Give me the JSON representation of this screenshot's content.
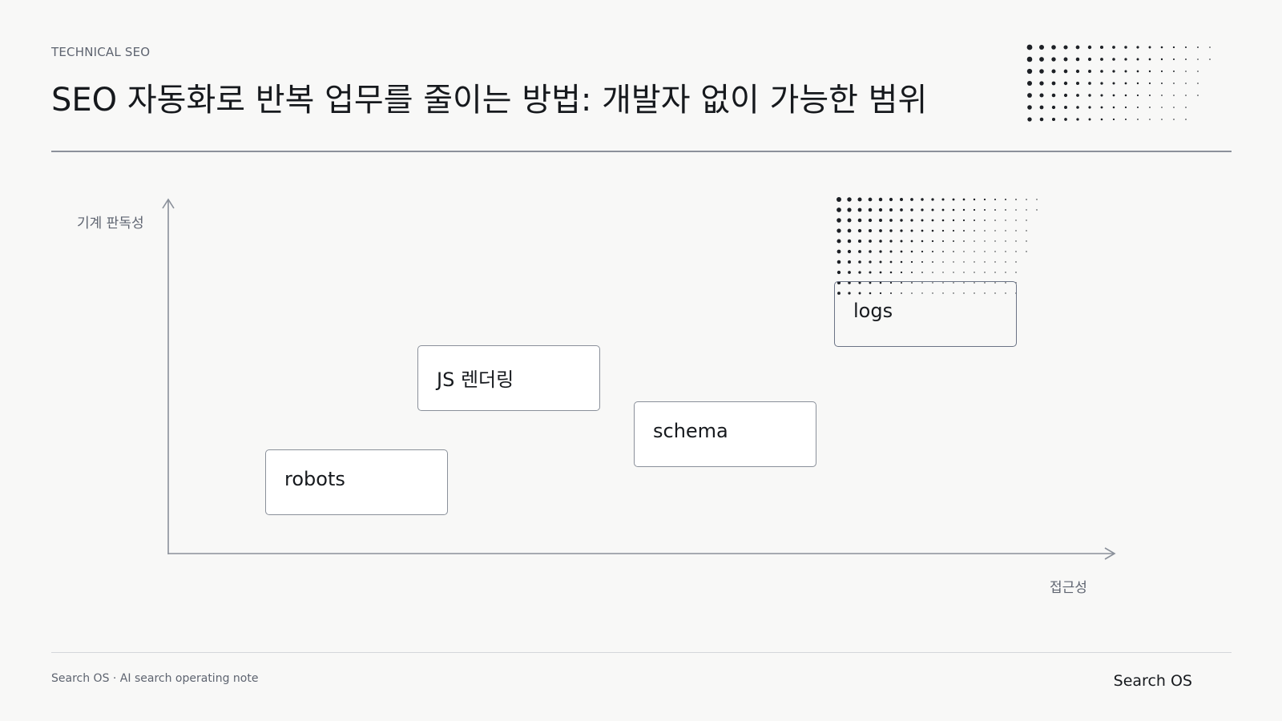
{
  "header": {
    "kicker": "TECHNICAL SEO",
    "title": "SEO 자동화로 반복 업무를 줄이는 방법: 개발자 없이 가능한 범위"
  },
  "diagram": {
    "y_axis_label": "기계 판독성",
    "x_axis_label": "접근성",
    "items": [
      {
        "label": "robots"
      },
      {
        "label": "JS 렌더링"
      },
      {
        "label": "schema"
      },
      {
        "label": "logs"
      }
    ]
  },
  "footer": {
    "note": "Search OS · AI search operating note",
    "brand": "Search OS"
  },
  "colors": {
    "background": "#f8f8f7",
    "text": "#16191d",
    "muted": "#5e6470",
    "axis": "#8a909a"
  }
}
